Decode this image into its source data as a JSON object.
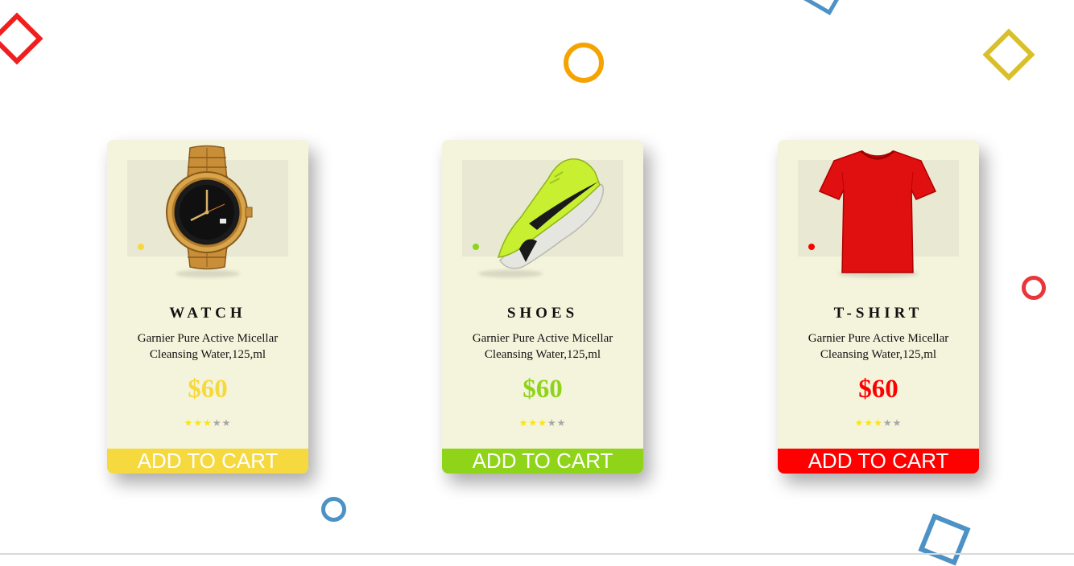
{
  "theme": {
    "card_background": "#f4f4dc",
    "image_panel": "#e8e8d3",
    "star_filled": "#f7e41b",
    "star_empty": "#a8a8a8",
    "shape_colors": [
      "#f01f1f",
      "#d9bf2a",
      "#4d92c6",
      "#f5a300",
      "#e8363a"
    ]
  },
  "products": [
    {
      "name": "WATCH",
      "description": "Garnier Pure Active Micellar Cleansing Water,125,ml",
      "price": "$60",
      "rating": 3,
      "rating_max": 5,
      "accent_color": "#f5d93f",
      "image_icon": "watch-icon",
      "button_label": "ADD TO CART"
    },
    {
      "name": "SHOES",
      "description": "Garnier Pure Active Micellar Cleansing Water,125,ml",
      "price": "$60",
      "rating": 3,
      "rating_max": 5,
      "accent_color": "#8fd418",
      "image_icon": "shoe-icon",
      "button_label": "ADD TO CART"
    },
    {
      "name": "T-SHIRT",
      "description": "Garnier Pure Active Micellar Cleansing Water,125,ml",
      "price": "$60",
      "rating": 3,
      "rating_max": 5,
      "accent_color": "#ff0000",
      "image_icon": "tshirt-icon",
      "button_label": "ADD TO CART"
    }
  ]
}
